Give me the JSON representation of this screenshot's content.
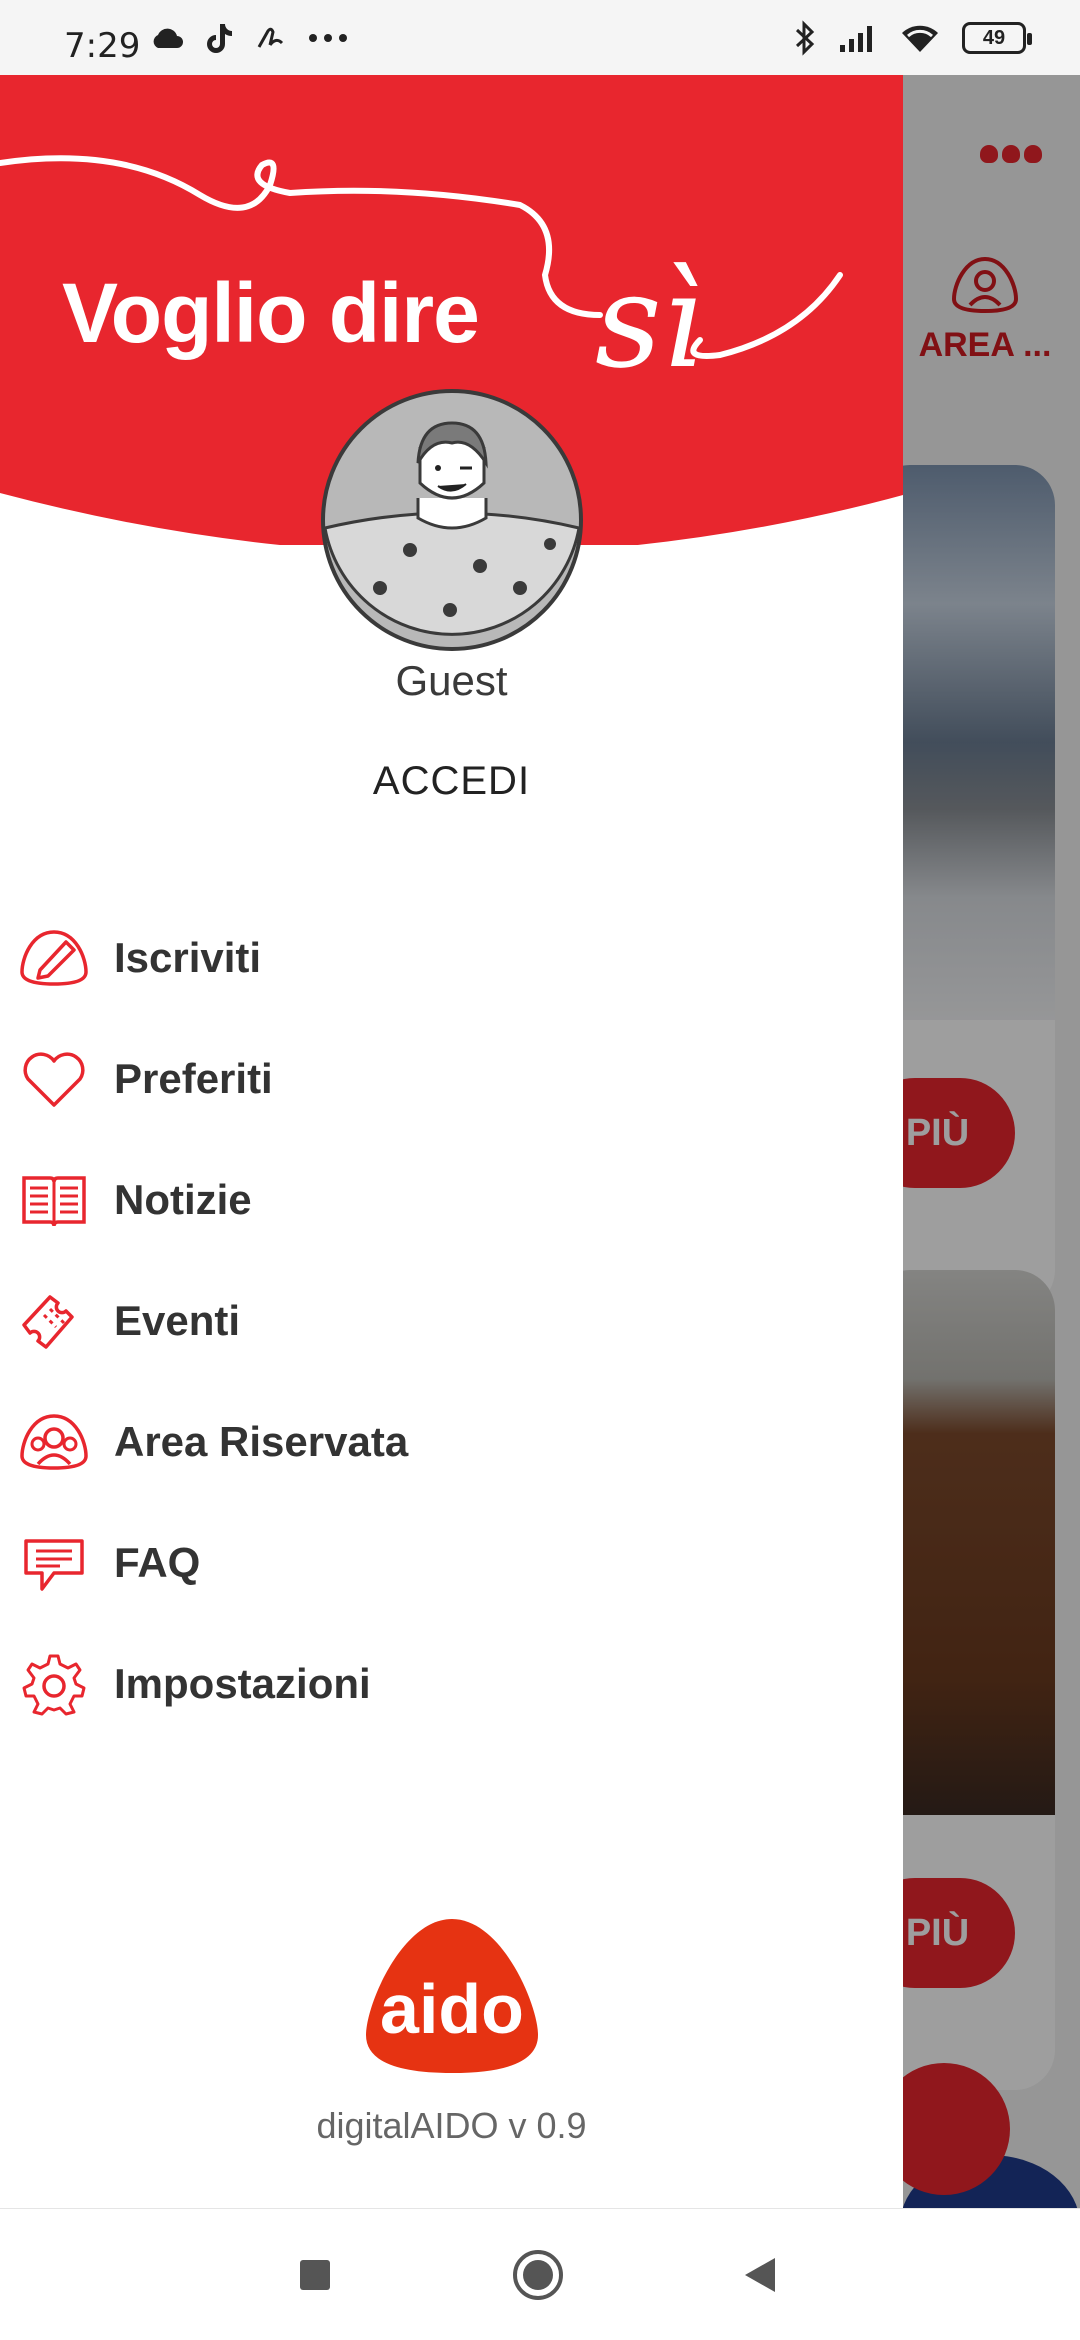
{
  "status_bar": {
    "time": "7:29",
    "left_icons": [
      "cloud-icon",
      "tiktok-icon",
      "signature-icon",
      "more-dots-icon"
    ],
    "right_icons": [
      "bluetooth-icon",
      "signal-icon",
      "wifi-icon"
    ],
    "battery_level": "49"
  },
  "background": {
    "area_label": "AREA ...",
    "more_label_1": "PIÙ",
    "more_label_2": "PIÙ"
  },
  "drawer": {
    "header": {
      "title": "Voglio dire",
      "title_script": "sì",
      "banner_color": "#e8262e"
    },
    "user": {
      "name": "Guest",
      "login_label": "ACCEDI"
    },
    "menu": [
      {
        "label": "Iscriviti",
        "icon": "pencil-icon"
      },
      {
        "label": "Preferiti",
        "icon": "heart-icon"
      },
      {
        "label": "Notizie",
        "icon": "newspaper-icon"
      },
      {
        "label": "Eventi",
        "icon": "ticket-icon"
      },
      {
        "label": "Area Riservata",
        "icon": "users-icon"
      },
      {
        "label": "FAQ",
        "icon": "chat-icon"
      },
      {
        "label": "Impostazioni",
        "icon": "gear-icon"
      }
    ],
    "footer": {
      "logo_text": "aido",
      "version": "digitalAIDO v 0.9"
    }
  },
  "colors": {
    "accent": "#e8262e",
    "text_dark": "#333333",
    "text_muted": "#666666"
  },
  "nav_bar": {
    "buttons": [
      "recents-button",
      "home-button",
      "back-button"
    ]
  }
}
